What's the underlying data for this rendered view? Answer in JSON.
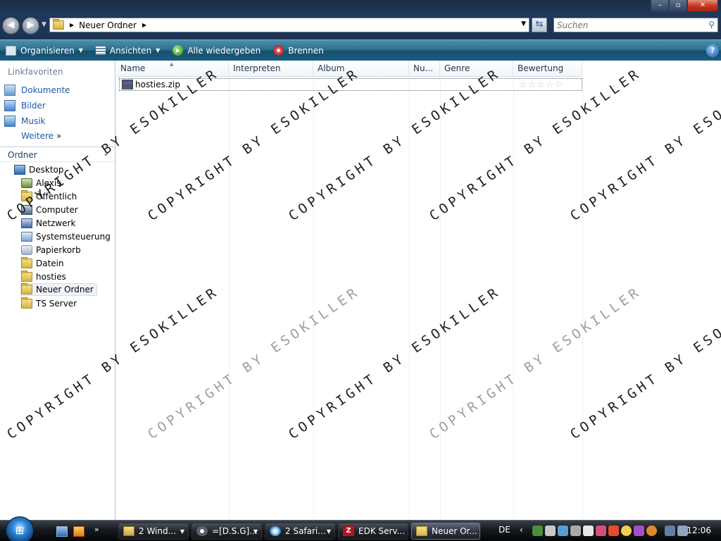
{
  "address": {
    "path_label": "Neuer Ordner",
    "search_placeholder": "Suchen"
  },
  "toolbar": {
    "organize": "Organisieren",
    "views": "Ansichten",
    "play_all": "Alle wiedergeben",
    "burn": "Brennen"
  },
  "sidebar": {
    "favorites_header": "Linkfavoriten",
    "favorites": [
      {
        "label": "Dokumente",
        "icon": "documents-icon"
      },
      {
        "label": "Bilder",
        "icon": "pictures-icon"
      },
      {
        "label": "Musik",
        "icon": "music-icon"
      }
    ],
    "more": "Weitere",
    "folders_header": "Ordner",
    "tree": [
      {
        "label": "Desktop",
        "icon": "desktop-icon"
      },
      {
        "label": "Alexis",
        "icon": "user-folder-icon"
      },
      {
        "label": "Öffentlich",
        "icon": "folder-icon"
      },
      {
        "label": "Computer",
        "icon": "computer-icon"
      },
      {
        "label": "Netzwerk",
        "icon": "network-icon"
      },
      {
        "label": "Systemsteuerung",
        "icon": "control-panel-icon"
      },
      {
        "label": "Papierkorb",
        "icon": "recycle-bin-icon"
      },
      {
        "label": "Datein",
        "icon": "folder-icon"
      },
      {
        "label": "hosties",
        "icon": "folder-icon"
      },
      {
        "label": "Neuer Ordner",
        "icon": "folder-icon",
        "selected": true
      },
      {
        "label": "TS Server",
        "icon": "folder-icon"
      }
    ]
  },
  "filelist": {
    "columns": [
      "Name",
      "Interpreten",
      "Album",
      "Nu...",
      "Genre",
      "Bewertung"
    ],
    "files": [
      {
        "name": "hosties.zip",
        "icon": "zip-archive-icon",
        "rating": 0
      }
    ]
  },
  "watermark_text": "COPYRIGHT BY ESOKILLER",
  "taskbar": {
    "buttons": [
      {
        "label": "2 Wind...",
        "icon": "windows-explorer-icon"
      },
      {
        "label": "=[D.S.G]...",
        "icon": "steam-icon"
      },
      {
        "label": "2 Safari...",
        "icon": "safari-icon"
      },
      {
        "label": "EDK Serv...",
        "icon": "filezilla-icon"
      },
      {
        "label": "Neuer Or...",
        "icon": "folder-icon"
      }
    ],
    "language": "DE",
    "clock": "12:06"
  },
  "colors": {
    "titlebar": "#1c3252",
    "toolbar": "#2f6f8f",
    "link_blue": "#1e5aa8",
    "taskbar": "#16191e"
  }
}
